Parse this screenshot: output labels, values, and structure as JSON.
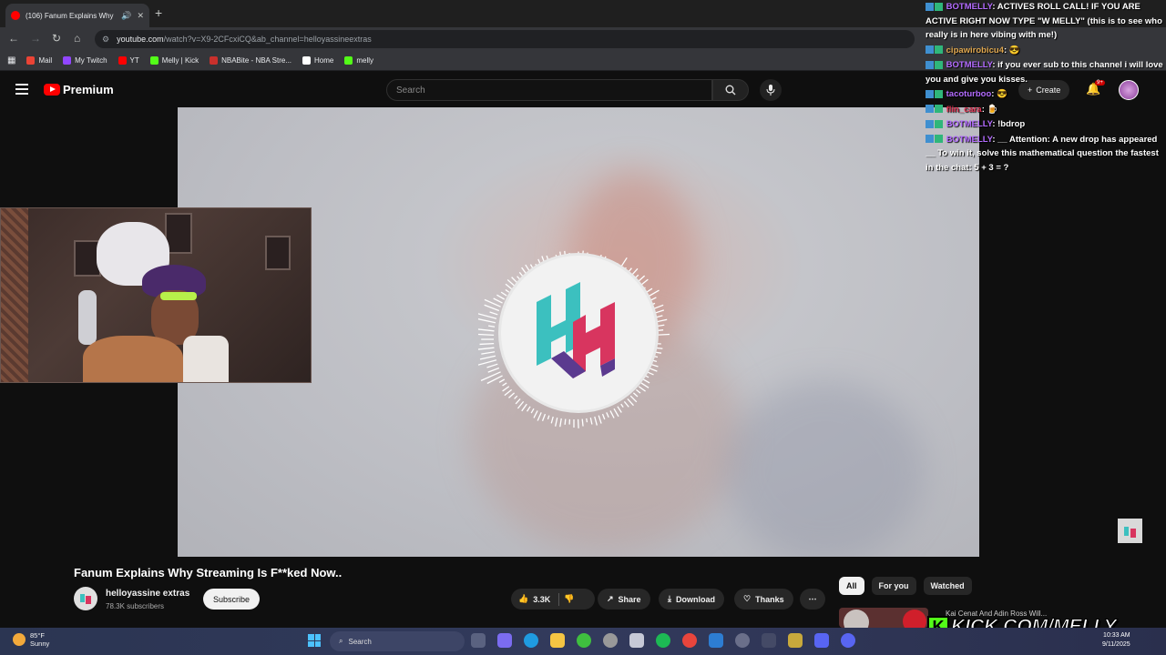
{
  "browser": {
    "tab_title": "(106) Fanum Explains Why",
    "tab_speaker": "🔊",
    "tab_close": "✕",
    "new_tab": "+",
    "url_main": "youtube.com",
    "url_rest": "/watch?v=X9-2CFcxiCQ&ab_channel=helloyassineextras",
    "bookmarks": [
      {
        "label": "Mail",
        "color": "#ea4335"
      },
      {
        "label": "My Twitch",
        "color": "#9146ff"
      },
      {
        "label": "YT",
        "color": "#ff0000"
      },
      {
        "label": "Melly | Kick",
        "color": "#53fc18"
      },
      {
        "label": "NBABite - NBA Stre...",
        "color": "#c9302c"
      },
      {
        "label": "Home",
        "color": "#ffffff"
      },
      {
        "label": "melly",
        "color": "#53fc18"
      }
    ]
  },
  "youtube": {
    "logo_text": "Premium",
    "search_placeholder": "Search",
    "create_label": "Create",
    "notifications_badge": "9+",
    "video_title": "Fanum Explains Why Streaming Is F**ked Now..",
    "channel_name": "helloyassine extras",
    "subscribers": "78.3K subscribers",
    "subscribe_label": "Subscribe",
    "likes": "3.3K",
    "share_label": "Share",
    "download_label": "Download",
    "thanks_label": "Thanks",
    "chips": [
      "All",
      "For you",
      "Watched"
    ],
    "next_video_title": "Kai Cenat And Adin Ross Will..."
  },
  "chat": [
    {
      "user": "BOTMELLY",
      "style": "user-bot",
      "text": ": ACTIVES ROLL CALL! IF YOU ARE ACTIVE RIGHT NOW TYPE \"W MELLY\" (this is to see who really is in here vibing with me!)"
    },
    {
      "user": "cipawirobicu4",
      "style": "user-green",
      "text": ": 😎"
    },
    {
      "user": "BOTMELLY",
      "style": "user-bot",
      "text": ": if you ever sub to this channel i will love you and give you kisses."
    },
    {
      "user": "tacoturboo",
      "style": "user-taco",
      "text": ": 😎"
    },
    {
      "user": "flin_cara",
      "style": "user-red",
      "text": ": 🍺"
    },
    {
      "user": "BOTMELLY",
      "style": "user-bot",
      "text": ": !bdrop"
    },
    {
      "user": "BOTMELLY",
      "style": "user-bot",
      "text": ": __ Attention: A new drop has appeared __ To win it, solve this mathematical question the fastest in the chat: 5 + 3 = ?"
    }
  ],
  "overlay": {
    "kick_letter": "K",
    "kick_text": "KICK.COM/MELLY"
  },
  "taskbar": {
    "temp": "85°F",
    "condition": "Sunny",
    "search_label": "Search",
    "time": "10:33 AM",
    "date": "9/11/2025"
  },
  "colors": {
    "youtube_red": "#ff0000",
    "kick_green": "#53fc18",
    "logo_teal": "#3cc0bf",
    "logo_pink": "#d8355f",
    "logo_purple": "#5b3a8f"
  }
}
